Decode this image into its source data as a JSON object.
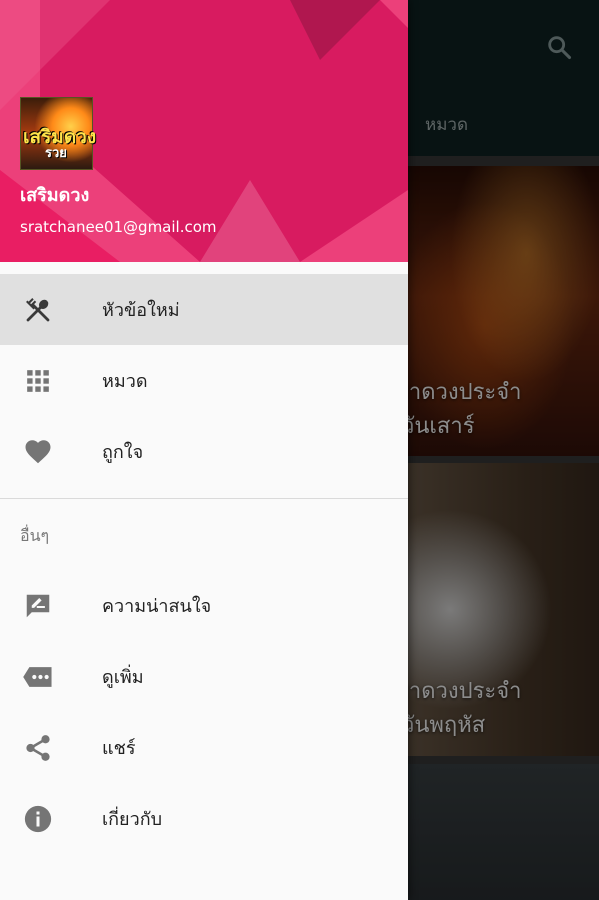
{
  "background": {
    "tab_label": "หมวด",
    "cards": [
      {
        "title": "บูชาดวงประจำ",
        "subtitle": "วันเสาร์"
      },
      {
        "title": "บูชาดวงประจำ",
        "subtitle": "วันพฤหัส"
      }
    ],
    "icons": {
      "search": "search-icon"
    }
  },
  "drawer": {
    "header": {
      "avatar_text_line1": "เสริมดวง",
      "avatar_text_line2": "รวย",
      "user_name": "เสริมดวง",
      "user_email": "sratchanee01@gmail.com",
      "colors": {
        "primary": "#e91e63",
        "dark": "#c2185b"
      }
    },
    "primary_items": [
      {
        "label": "หัวข้อใหม่",
        "icon": "fork-spoon-icon",
        "active": true
      },
      {
        "label": "หมวด",
        "icon": "grid-icon",
        "active": false
      },
      {
        "label": "ถูกใจ",
        "icon": "heart-icon",
        "active": false
      }
    ],
    "section_title": "อื่นๆ",
    "secondary_items": [
      {
        "label": "ความน่าสนใจ",
        "icon": "rate-review-icon"
      },
      {
        "label": "ดูเพิ่ม",
        "icon": "more-tag-icon"
      },
      {
        "label": "แชร์",
        "icon": "share-icon"
      },
      {
        "label": "เกี่ยวกับ",
        "icon": "info-icon"
      }
    ]
  }
}
